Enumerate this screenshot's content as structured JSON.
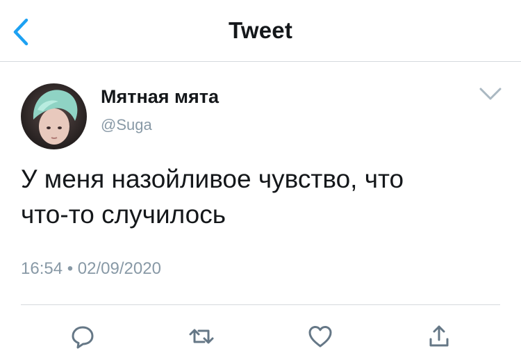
{
  "header": {
    "title": "Tweet",
    "back_icon": "chevron-left-icon"
  },
  "tweet": {
    "author": {
      "display_name": "Мятная мята",
      "handle": "@Suga",
      "avatar_icon": "avatar"
    },
    "text_lines": [
      "У меня назойливое чувство, что",
      "что-то случилось"
    ],
    "timestamp": "16:54 • 02/09/2020",
    "more_icon": "chevron-down-icon"
  },
  "actions": [
    {
      "icon": "reply-icon"
    },
    {
      "icon": "retweet-icon"
    },
    {
      "icon": "like-icon"
    },
    {
      "icon": "share-icon"
    }
  ],
  "colors": {
    "accent": "#1da1f2",
    "text": "#14171a",
    "secondary": "#8899a6",
    "divider": "#d5d9dd"
  }
}
